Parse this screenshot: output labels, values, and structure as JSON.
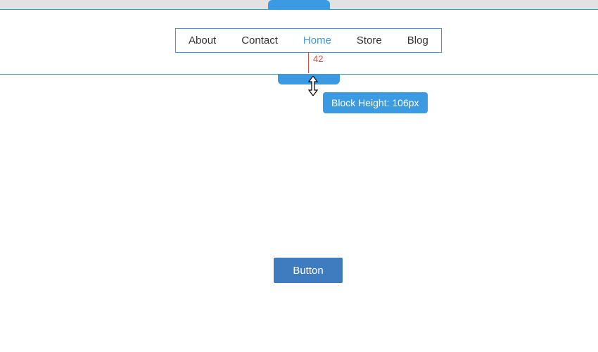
{
  "nav": {
    "items": [
      {
        "label": "About",
        "active": false
      },
      {
        "label": "Contact",
        "active": false
      },
      {
        "label": "Home",
        "active": true
      },
      {
        "label": "Store",
        "active": false
      },
      {
        "label": "Blog",
        "active": false
      }
    ]
  },
  "measurement": {
    "value": "42"
  },
  "tooltip": {
    "text": "Block Height: 106px"
  },
  "button": {
    "label": "Button"
  }
}
